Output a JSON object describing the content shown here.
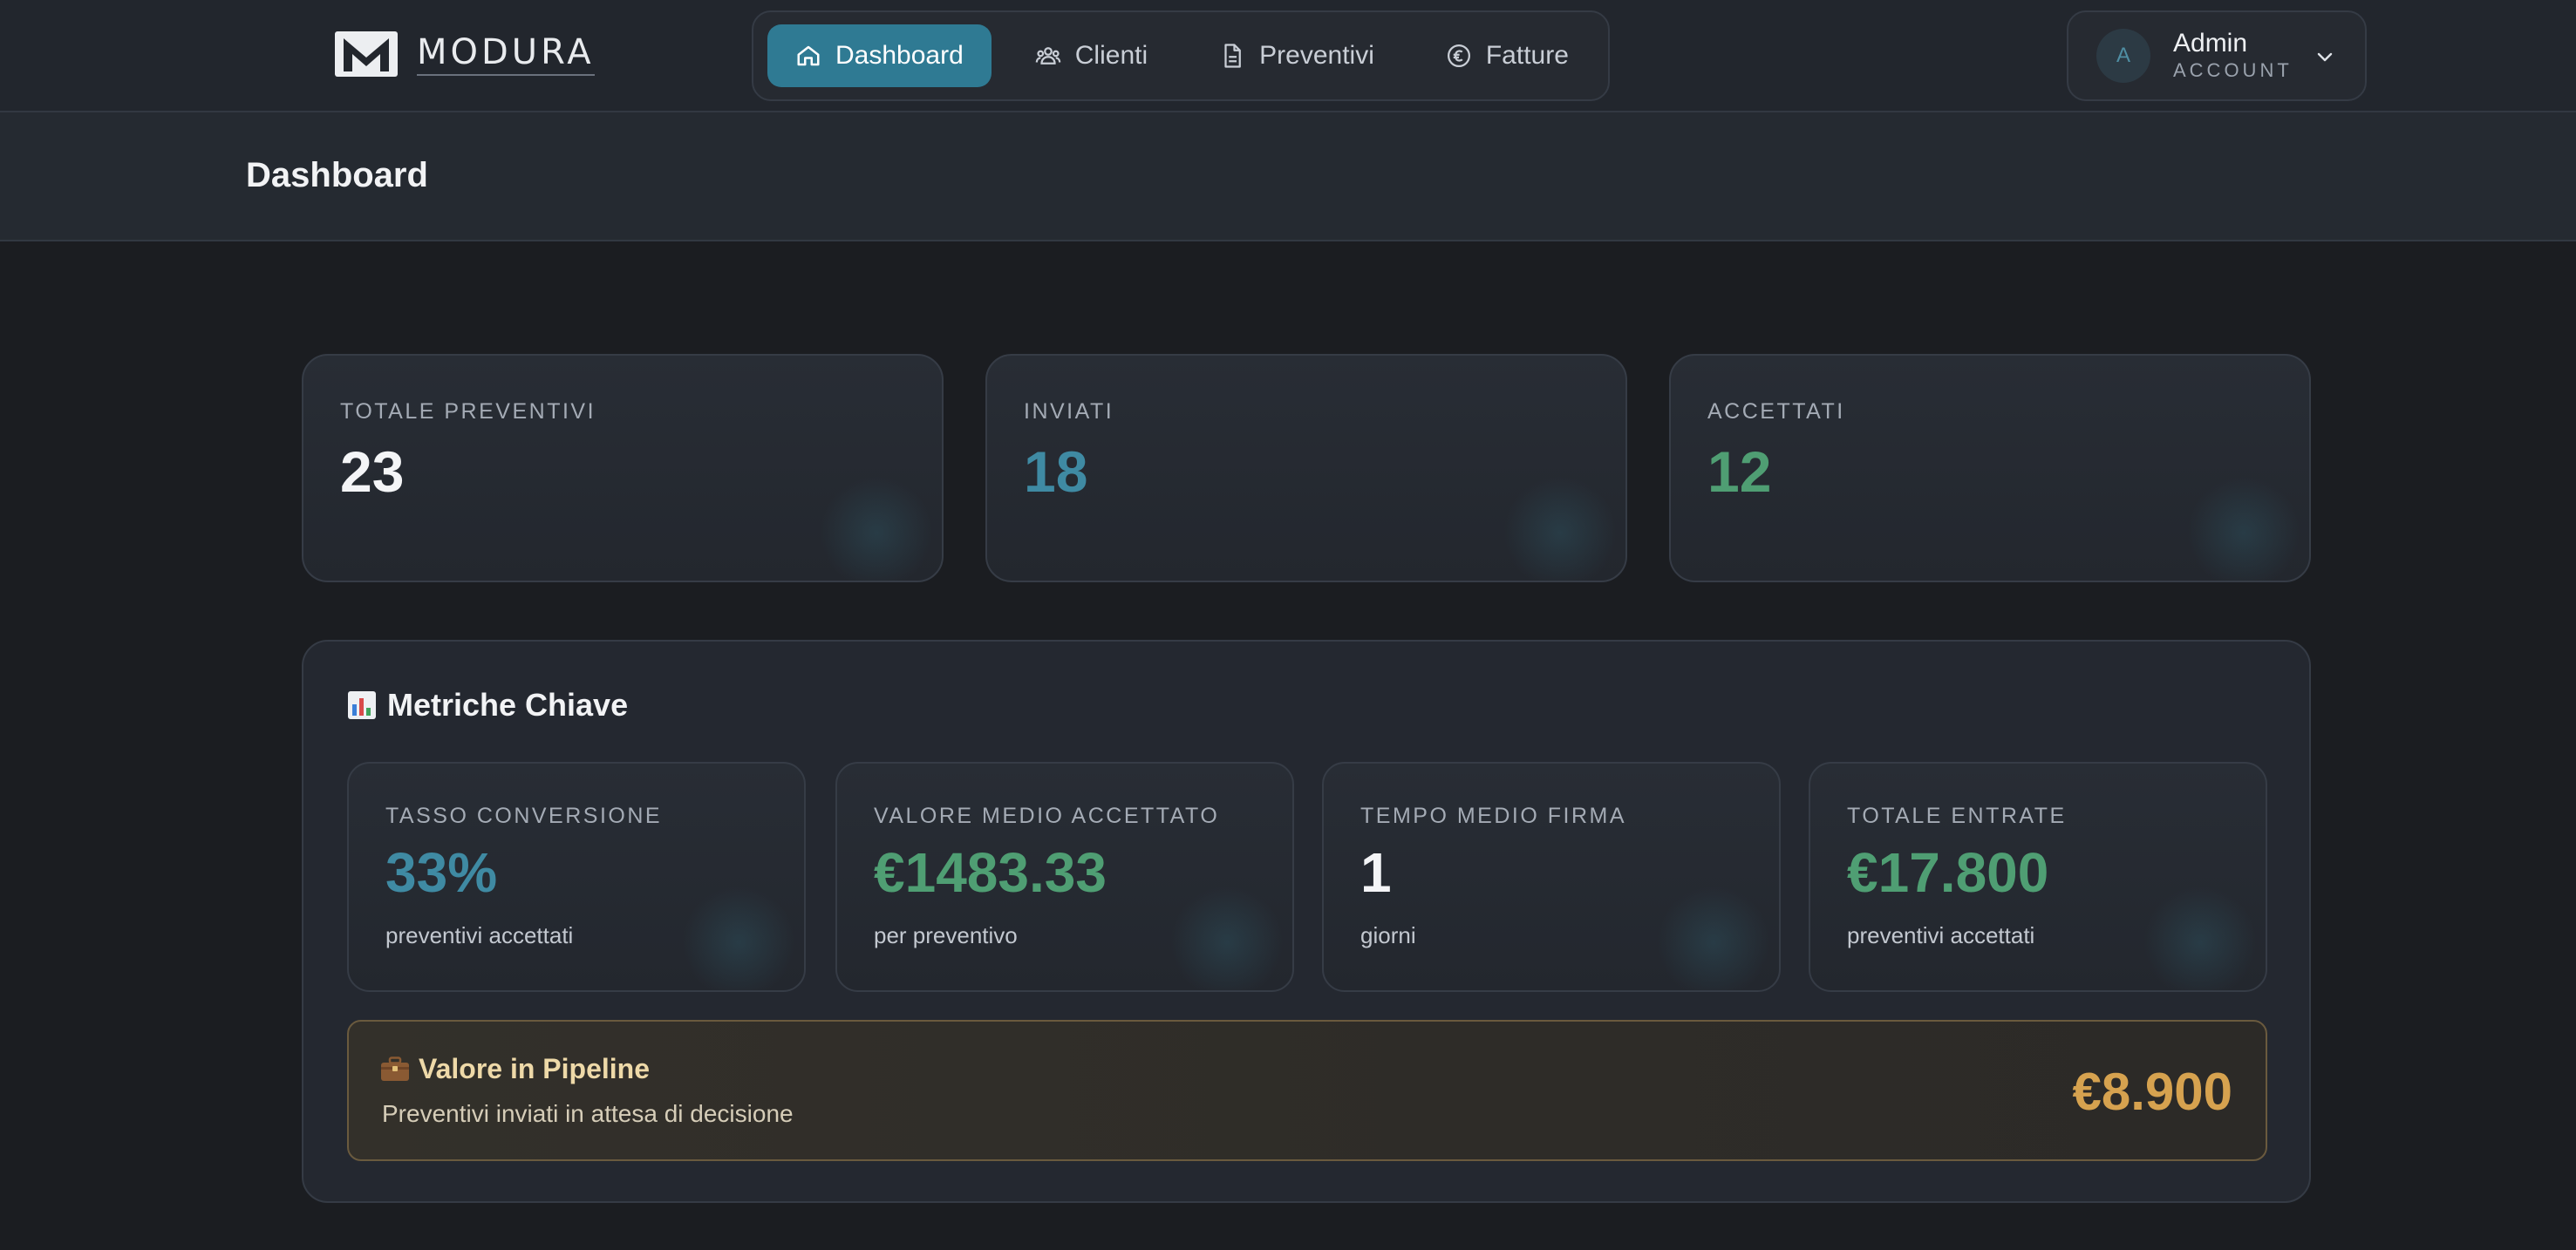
{
  "brand": {
    "name": "MODURA"
  },
  "nav": {
    "items": [
      {
        "label": "Dashboard",
        "icon": "home-icon",
        "active": true
      },
      {
        "label": "Clienti",
        "icon": "users-icon",
        "active": false
      },
      {
        "label": "Preventivi",
        "icon": "document-icon",
        "active": false
      },
      {
        "label": "Fatture",
        "icon": "euro-icon",
        "active": false
      }
    ]
  },
  "account": {
    "initial": "A",
    "name": "Admin",
    "role": "ACCOUNT"
  },
  "page": {
    "title": "Dashboard"
  },
  "stats": [
    {
      "label": "TOTALE PREVENTIVI",
      "value": "23",
      "color": "#f4f5f7"
    },
    {
      "label": "INVIATI",
      "value": "18",
      "color": "#3f8aa3"
    },
    {
      "label": "ACCETTATI",
      "value": "12",
      "color": "#4f9e73"
    }
  ],
  "metrics": {
    "title": "Metriche Chiave",
    "cards": [
      {
        "label": "TASSO CONVERSIONE",
        "value": "33%",
        "sub": "preventivi accettati",
        "color": "#3f8aa3"
      },
      {
        "label": "VALORE MEDIO ACCETTATO",
        "value": "€1483.33",
        "sub": "per preventivo",
        "color": "#4f9e73"
      },
      {
        "label": "TEMPO MEDIO FIRMA",
        "value": "1",
        "sub": "giorni",
        "color": "#f4f5f7"
      },
      {
        "label": "TOTALE ENTRATE",
        "value": "€17.800",
        "sub": "preventivi accettati",
        "color": "#4f9e73"
      }
    ],
    "pipeline": {
      "title": "Valore in Pipeline",
      "subtitle": "Preventivi inviati in attesa di decisione",
      "value": "€8.900"
    }
  }
}
